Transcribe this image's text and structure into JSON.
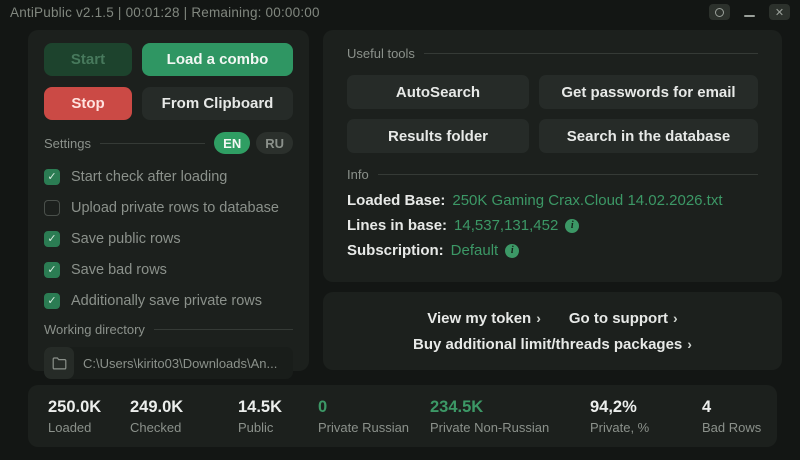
{
  "titlebar": {
    "title": "AntiPublic v2.1.5 | 00:01:28 | Remaining: 00:00:00"
  },
  "left_panel": {
    "buttons": {
      "start": "Start",
      "load_combo": "Load a combo",
      "stop": "Stop",
      "from_clipboard": "From Clipboard"
    },
    "settings": {
      "label": "Settings",
      "languages": [
        {
          "label": "EN",
          "active": true
        },
        {
          "label": "RU",
          "active": false
        }
      ],
      "checkboxes": [
        {
          "label": "Start check after loading",
          "checked": true
        },
        {
          "label": "Upload private rows to database",
          "checked": false
        },
        {
          "label": "Save public rows",
          "checked": true
        },
        {
          "label": "Save bad rows",
          "checked": true
        },
        {
          "label": "Additionally save private rows",
          "checked": true
        }
      ]
    },
    "working_directory": {
      "label": "Working directory",
      "path": "C:\\Users\\kirito03\\Downloads\\An..."
    }
  },
  "tools_panel": {
    "label": "Useful tools",
    "buttons": {
      "autosearch": "AutoSearch",
      "get_passwords": "Get passwords for email",
      "results_folder": "Results folder",
      "search_db": "Search in the database"
    },
    "info": {
      "label": "Info",
      "rows": [
        {
          "label": "Loaded Base:",
          "value": "250K Gaming Crax.Cloud 14.02.2026.txt",
          "info_icon": false
        },
        {
          "label": "Lines in base:",
          "value": "14,537,131,452",
          "info_icon": true
        },
        {
          "label": "Subscription:",
          "value": "Default",
          "info_icon": true
        }
      ]
    }
  },
  "links_panel": {
    "links": [
      {
        "label": "View my token",
        "chevron": "›"
      },
      {
        "label": "Go to support",
        "chevron": "›"
      },
      {
        "label": "Buy additional limit/threads packages",
        "chevron": "›"
      }
    ]
  },
  "stats": [
    {
      "value": "250.0K",
      "label": "Loaded",
      "green": false
    },
    {
      "value": "249.0K",
      "label": "Checked",
      "green": false
    },
    {
      "value": "14.5K",
      "label": "Public",
      "green": false
    },
    {
      "value": "0",
      "label": "Private Russian",
      "green": true
    },
    {
      "value": "234.5K",
      "label": "Private Non-Russian",
      "green": true
    },
    {
      "value": "94,2%",
      "label": "Private, %",
      "green": false
    },
    {
      "value": "4",
      "label": "Bad Rows",
      "green": false
    }
  ],
  "icons": {
    "info": "i"
  },
  "colors": {
    "background": "#131614",
    "card": "#1c201d",
    "accent_green": "#2f9663",
    "text_green": "#3c9866",
    "stop_red": "#cb4a45",
    "muted_text": "#8b918b"
  }
}
